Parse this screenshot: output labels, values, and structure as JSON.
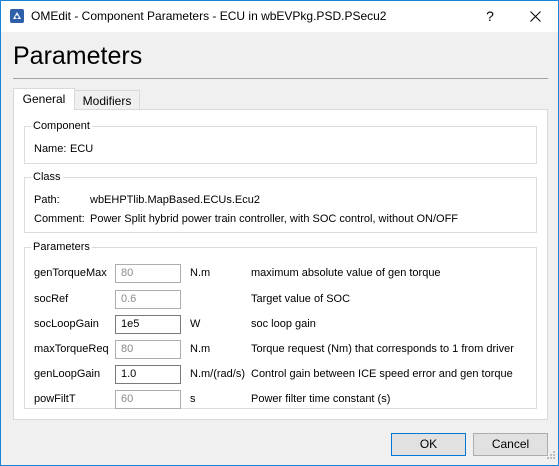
{
  "window": {
    "title": "OMEdit - Component Parameters - ECU in wbEVPkg.PSD.PSecu2",
    "help_label": "?"
  },
  "page_title": "Parameters",
  "tabs": [
    {
      "label": "General",
      "selected": true
    },
    {
      "label": "Modifiers",
      "selected": false
    }
  ],
  "component": {
    "group_title": "Component",
    "name_label": "Name:",
    "name_value": "ECU"
  },
  "class": {
    "group_title": "Class",
    "path_label": "Path:",
    "path_value": "wbEHPTlib.MapBased.ECUs.Ecu2",
    "comment_label": "Comment:",
    "comment_value": "Power Split hybrid power train controller, with SOC control, without ON/OFF"
  },
  "parameters": {
    "group_title": "Parameters",
    "rows": [
      {
        "name": "genTorqueMax",
        "value": "80",
        "is_placeholder": true,
        "unit": "N.m",
        "description": "maximum absolute value of gen torque"
      },
      {
        "name": "socRef",
        "value": "0.6",
        "is_placeholder": true,
        "unit": "",
        "description": "Target value of SOC"
      },
      {
        "name": "socLoopGain",
        "value": "1e5",
        "is_placeholder": false,
        "unit": "W",
        "description": "soc loop gain"
      },
      {
        "name": "maxTorqueReq",
        "value": "80",
        "is_placeholder": true,
        "unit": "N.m",
        "description": "Torque request (Nm) that corresponds to 1 from driver"
      },
      {
        "name": "genLoopGain",
        "value": "1.0",
        "is_placeholder": false,
        "unit": "N.m/(rad/s)",
        "description": "Control gain between ICE speed error and gen torque"
      },
      {
        "name": "powFiltT",
        "value": "60",
        "is_placeholder": true,
        "unit": "s",
        "description": "Power filter time constant (s)"
      }
    ]
  },
  "buttons": {
    "ok_label": "OK",
    "cancel_label": "Cancel"
  },
  "colors": {
    "window_border": "#1883d7",
    "placeholder_text": "#8a8a8a",
    "default_button_border": "#0078d7"
  }
}
